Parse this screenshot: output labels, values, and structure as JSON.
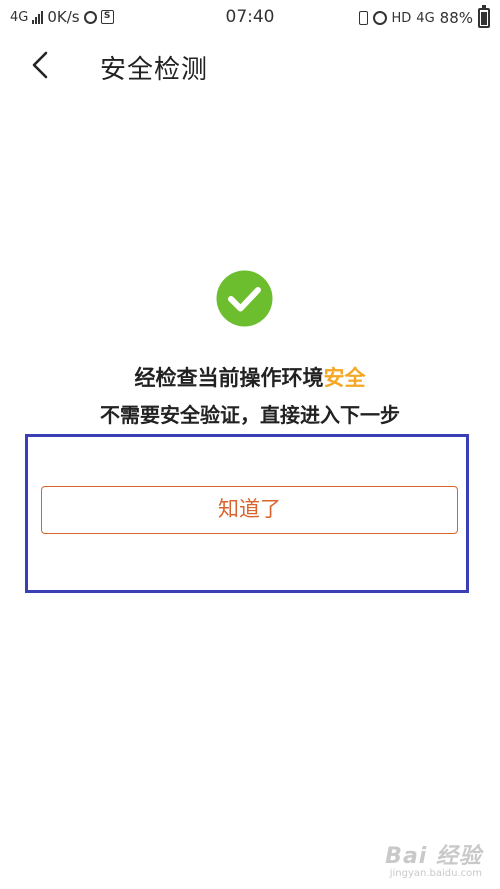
{
  "status_bar": {
    "network_left": "4G",
    "speed": "0K/s",
    "time": "07:40",
    "hd": "HD",
    "network_right": "4G",
    "battery_percent": "88%"
  },
  "header": {
    "title": "安全检测"
  },
  "result": {
    "line1_prefix": "经检查当前操作环境",
    "line1_highlight": "安全",
    "line2": "不需要安全验证，直接进入下一步",
    "highlight_color": "#f5a623",
    "check_color": "#6cbe2f"
  },
  "actions": {
    "confirm_label": "知道了",
    "button_color": "#d9652c"
  },
  "annotation": {
    "color": "#3b3fb5"
  },
  "watermark": {
    "main": "Bai 经验",
    "sub": "jingyan.baidu.com"
  }
}
